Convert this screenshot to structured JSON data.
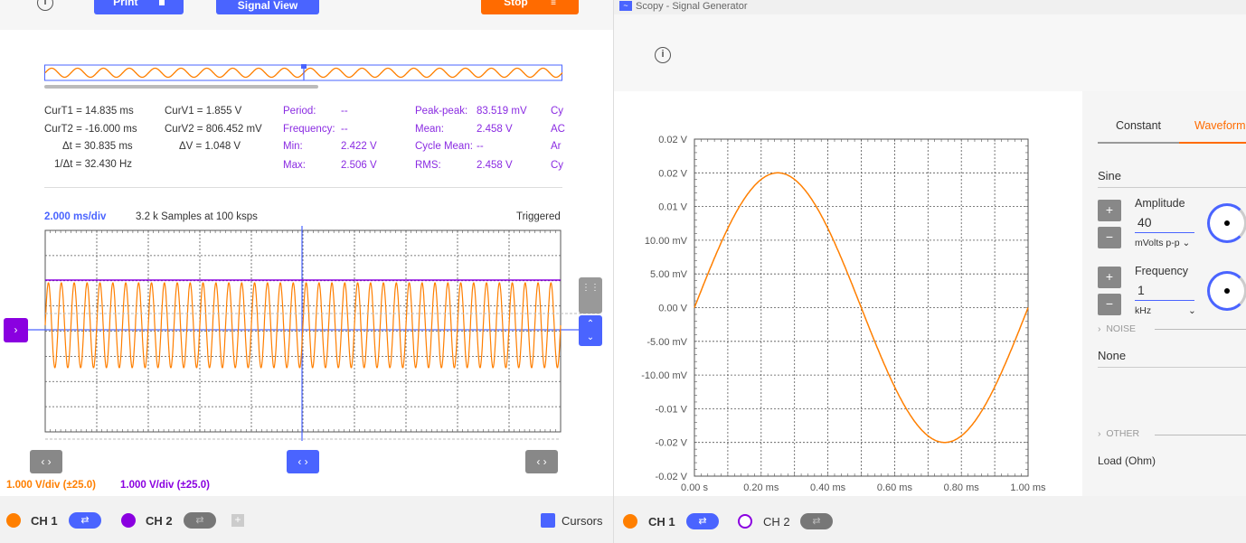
{
  "left": {
    "toolbar": {
      "print_label": "Print",
      "signal_view_label": "Signal View",
      "stop_label": "Stop"
    },
    "cursors": {
      "curt1": "CurT1 = 14.835 ms",
      "curt2": "CurT2 = -16.000 ms",
      "dt": "Δt = 30.835 ms",
      "inv_dt": "1/Δt = 32.430 Hz",
      "curv1": "CurV1 = 1.855 V",
      "curv2": "CurV2 = 806.452 mV",
      "dv": "ΔV = 1.048 V"
    },
    "measurements": {
      "period_label": "Period:",
      "period_value": "--",
      "frequency_label": "Frequency:",
      "frequency_value": "--",
      "min_label": "Min:",
      "min_value": "2.422 V",
      "max_label": "Max:",
      "max_value": "2.506 V",
      "peakpeak_label": "Peak-peak:",
      "peakpeak_value": "83.519 mV",
      "mean_label": "Mean:",
      "mean_value": "2.458 V",
      "cyclemean_label": "Cycle Mean:",
      "cyclemean_value": "--",
      "rms_label": "RMS:",
      "rms_value": "2.458 V",
      "cut1": "Cy",
      "cut2": "AC",
      "cut3": "Ar",
      "cut4": "Cy"
    },
    "plot": {
      "timebase": "2.000 ms/div",
      "samples": "3.2 k Samples at 100 ksps",
      "trigger_status": "Triggered"
    },
    "scales": {
      "ch1": "1.000 V/div (±25.0)",
      "ch2": "1.000 V/div (±25.0)"
    },
    "bottom": {
      "ch1": "CH 1",
      "ch2": "CH 2",
      "cursors": "Cursors"
    },
    "colors": {
      "ch1": "#ff7f00",
      "ch2": "#8a00e0",
      "accent": "#4a64ff"
    }
  },
  "right": {
    "window_title": "Scopy - Signal Generator",
    "tabs": {
      "constant": "Constant",
      "waveform": "Waveform"
    },
    "waveform_type": "Sine",
    "amplitude": {
      "label": "Amplitude",
      "value": "40",
      "unit": "mVolts p-p"
    },
    "frequency": {
      "label": "Frequency",
      "value": "1",
      "unit": "kHz"
    },
    "noise_section": "NOISE",
    "noise_value": "None",
    "other_section": "OTHER",
    "load_label": "Load (Ohm)",
    "bottom": {
      "ch1": "CH 1",
      "ch2": "CH 2"
    }
  },
  "chart_data": {
    "type": "line",
    "title": "",
    "xlabel": "",
    "ylabel": "",
    "x_ticks": [
      "0.00 s",
      "0.20 ms",
      "0.40 ms",
      "0.60 ms",
      "0.80 ms",
      "1.00 ms"
    ],
    "y_ticks": [
      "0.02 V",
      "0.02 V",
      "0.01 V",
      "10.00 mV",
      "5.00 mV",
      "0.00 V",
      "-5.00 mV",
      "-10.00 mV",
      "-0.01 V",
      "-0.02 V",
      "-0.02 V"
    ],
    "xlim": [
      0,
      1.0
    ],
    "ylim": [
      -25,
      25
    ],
    "grid": true,
    "series": [
      {
        "color": "#ff7f00",
        "amplitude_mV": 20,
        "frequency_kHz": 1,
        "x_ms": [
          0,
          0.125,
          0.25,
          0.375,
          0.5,
          0.625,
          0.75,
          0.875,
          1.0
        ],
        "y_mV": [
          0,
          14.14,
          20,
          14.14,
          0,
          -14.14,
          -20,
          -14.14,
          0
        ]
      }
    ]
  }
}
